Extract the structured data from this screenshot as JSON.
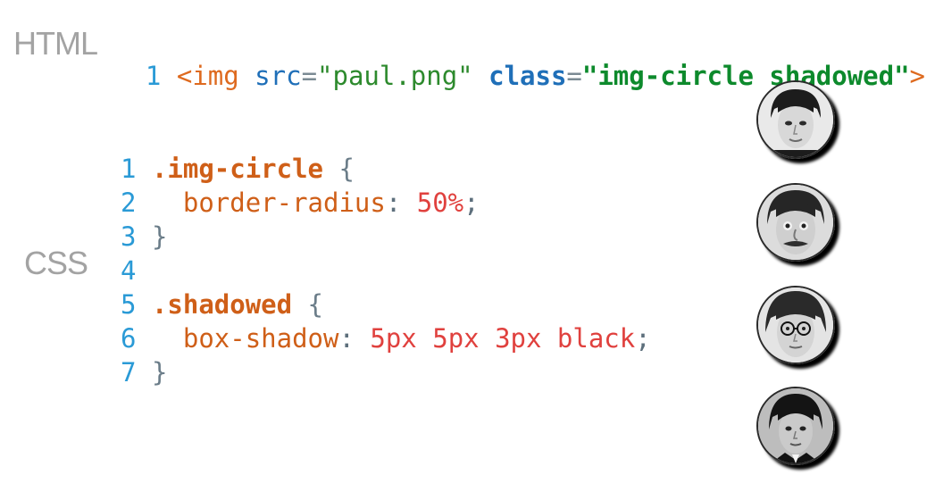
{
  "html_label": "HTML",
  "css_label": "CSS",
  "html_line": {
    "num": "1",
    "open": "<img",
    "src_attr": "src",
    "eq1": "=",
    "src_val": "\"paul.png\"",
    "class_attr": "class",
    "eq2": "=",
    "class_val": "\"img-circle shadowed\"",
    "close": ">"
  },
  "css_lines": [
    {
      "num": "1",
      "selector": ".img-circle",
      "brace": " {"
    },
    {
      "num": "2",
      "prop": "border-radius",
      "colon": ": ",
      "value": "50%",
      "semi": ";"
    },
    {
      "num": "3",
      "brace": "}"
    },
    {
      "num": "4"
    },
    {
      "num": "5",
      "selector": ".shadowed",
      "brace": " {"
    },
    {
      "num": "6",
      "prop": "box-shadow",
      "colon": ": ",
      "value": "5px 5px 3px black",
      "semi": ";"
    },
    {
      "num": "7",
      "brace": "}"
    }
  ],
  "colors": {
    "line_number": "#2a9ad6",
    "tag": "#de6a1f",
    "attribute": "#1f6fb8",
    "string": "#0d8a2c",
    "selector": "#cf5f18",
    "value": "#e0413e",
    "label": "#a3a3a3"
  },
  "portraits": [
    "portrait-1",
    "portrait-2",
    "portrait-3",
    "portrait-4"
  ]
}
